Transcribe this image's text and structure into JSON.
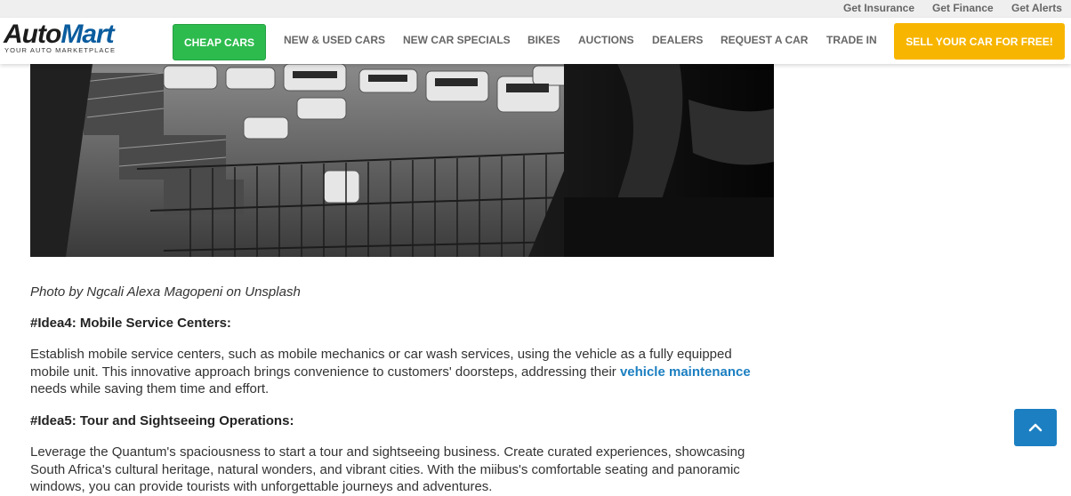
{
  "utility": {
    "insurance": "Get Insurance",
    "finance": "Get Finance",
    "alerts": "Get Alerts"
  },
  "logo": {
    "auto": "Auto",
    "mart": "Mart",
    "tagline": "YOUR AUTO MARKETPLACE"
  },
  "nav": {
    "cheap_cars": "CHEAP CARS",
    "new_used": "NEW & USED CARS",
    "specials": "NEW CAR SPECIALS",
    "bikes": "BIKES",
    "auctions": "AUCTIONS",
    "dealers": "DEALERS",
    "request": "REQUEST A CAR",
    "trade_in": "TRADE IN",
    "sell": "SELL YOUR CAR FOR FREE!"
  },
  "article": {
    "caption": "Photo by Ngcali Alexa Magopeni on Unsplash",
    "idea4_title": "#Idea4: Mobile Service Centers:",
    "idea4_text_before": "Establish mobile service centers, such as mobile mechanics or car wash services, using the vehicle as a fully equipped mobile unit. This innovative approach brings convenience to customers' doorsteps, addressing their ",
    "idea4_link": "vehicle maintenance",
    "idea4_text_after": " needs while saving them time and effort.",
    "idea5_title": "#Idea5: Tour and Sightseeing Operations:",
    "idea5_text": "Leverage the Quantum's spaciousness to start a tour and sightseeing business. Create curated experiences, showcasing South Africa's cultural heritage, natural wonders, and vibrant cities. With the miibus's comfortable seating and panoramic windows, you can provide tourists with unforgettable journeys and adventures."
  },
  "colors": {
    "cheap_button": "#2dbb4e",
    "sell_button": "#f7b500",
    "link": "#1b7fc1",
    "to_top": "#1b7fc1"
  },
  "icons": {
    "to_top": "chevron-up-icon"
  }
}
